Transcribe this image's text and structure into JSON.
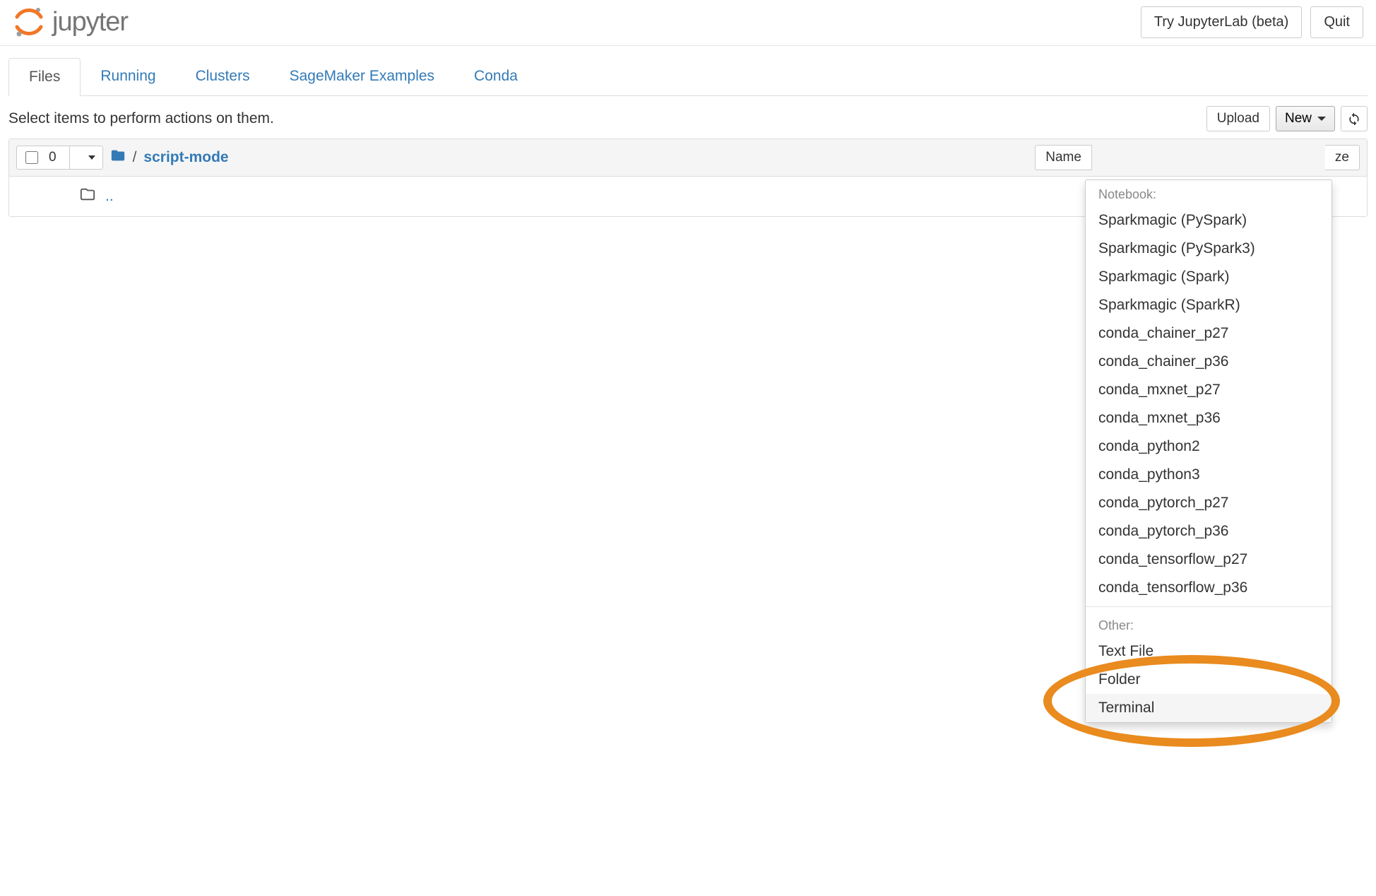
{
  "header": {
    "logo_text": "jupyter",
    "try_label": "Try JupyterLab (beta)",
    "quit_label": "Quit"
  },
  "tabs": {
    "files": "Files",
    "running": "Running",
    "clusters": "Clusters",
    "sagemaker": "SageMaker Examples",
    "conda": "Conda"
  },
  "toolbar": {
    "prompt": "Select items to perform actions on them.",
    "upload": "Upload",
    "new": "New"
  },
  "listing": {
    "selected_count": "0",
    "breadcrumb_current": "script-mode",
    "col_name": "Name",
    "col_size_tail": "ze",
    "updir": ".."
  },
  "dropdown": {
    "section_notebook": "Notebook:",
    "notebook_items": [
      "Sparkmagic (PySpark)",
      "Sparkmagic (PySpark3)",
      "Sparkmagic (Spark)",
      "Sparkmagic (SparkR)",
      "conda_chainer_p27",
      "conda_chainer_p36",
      "conda_mxnet_p27",
      "conda_mxnet_p36",
      "conda_python2",
      "conda_python3",
      "conda_pytorch_p27",
      "conda_pytorch_p36",
      "conda_tensorflow_p27",
      "conda_tensorflow_p36"
    ],
    "section_other": "Other:",
    "other_items": [
      "Text File",
      "Folder",
      "Terminal"
    ]
  }
}
